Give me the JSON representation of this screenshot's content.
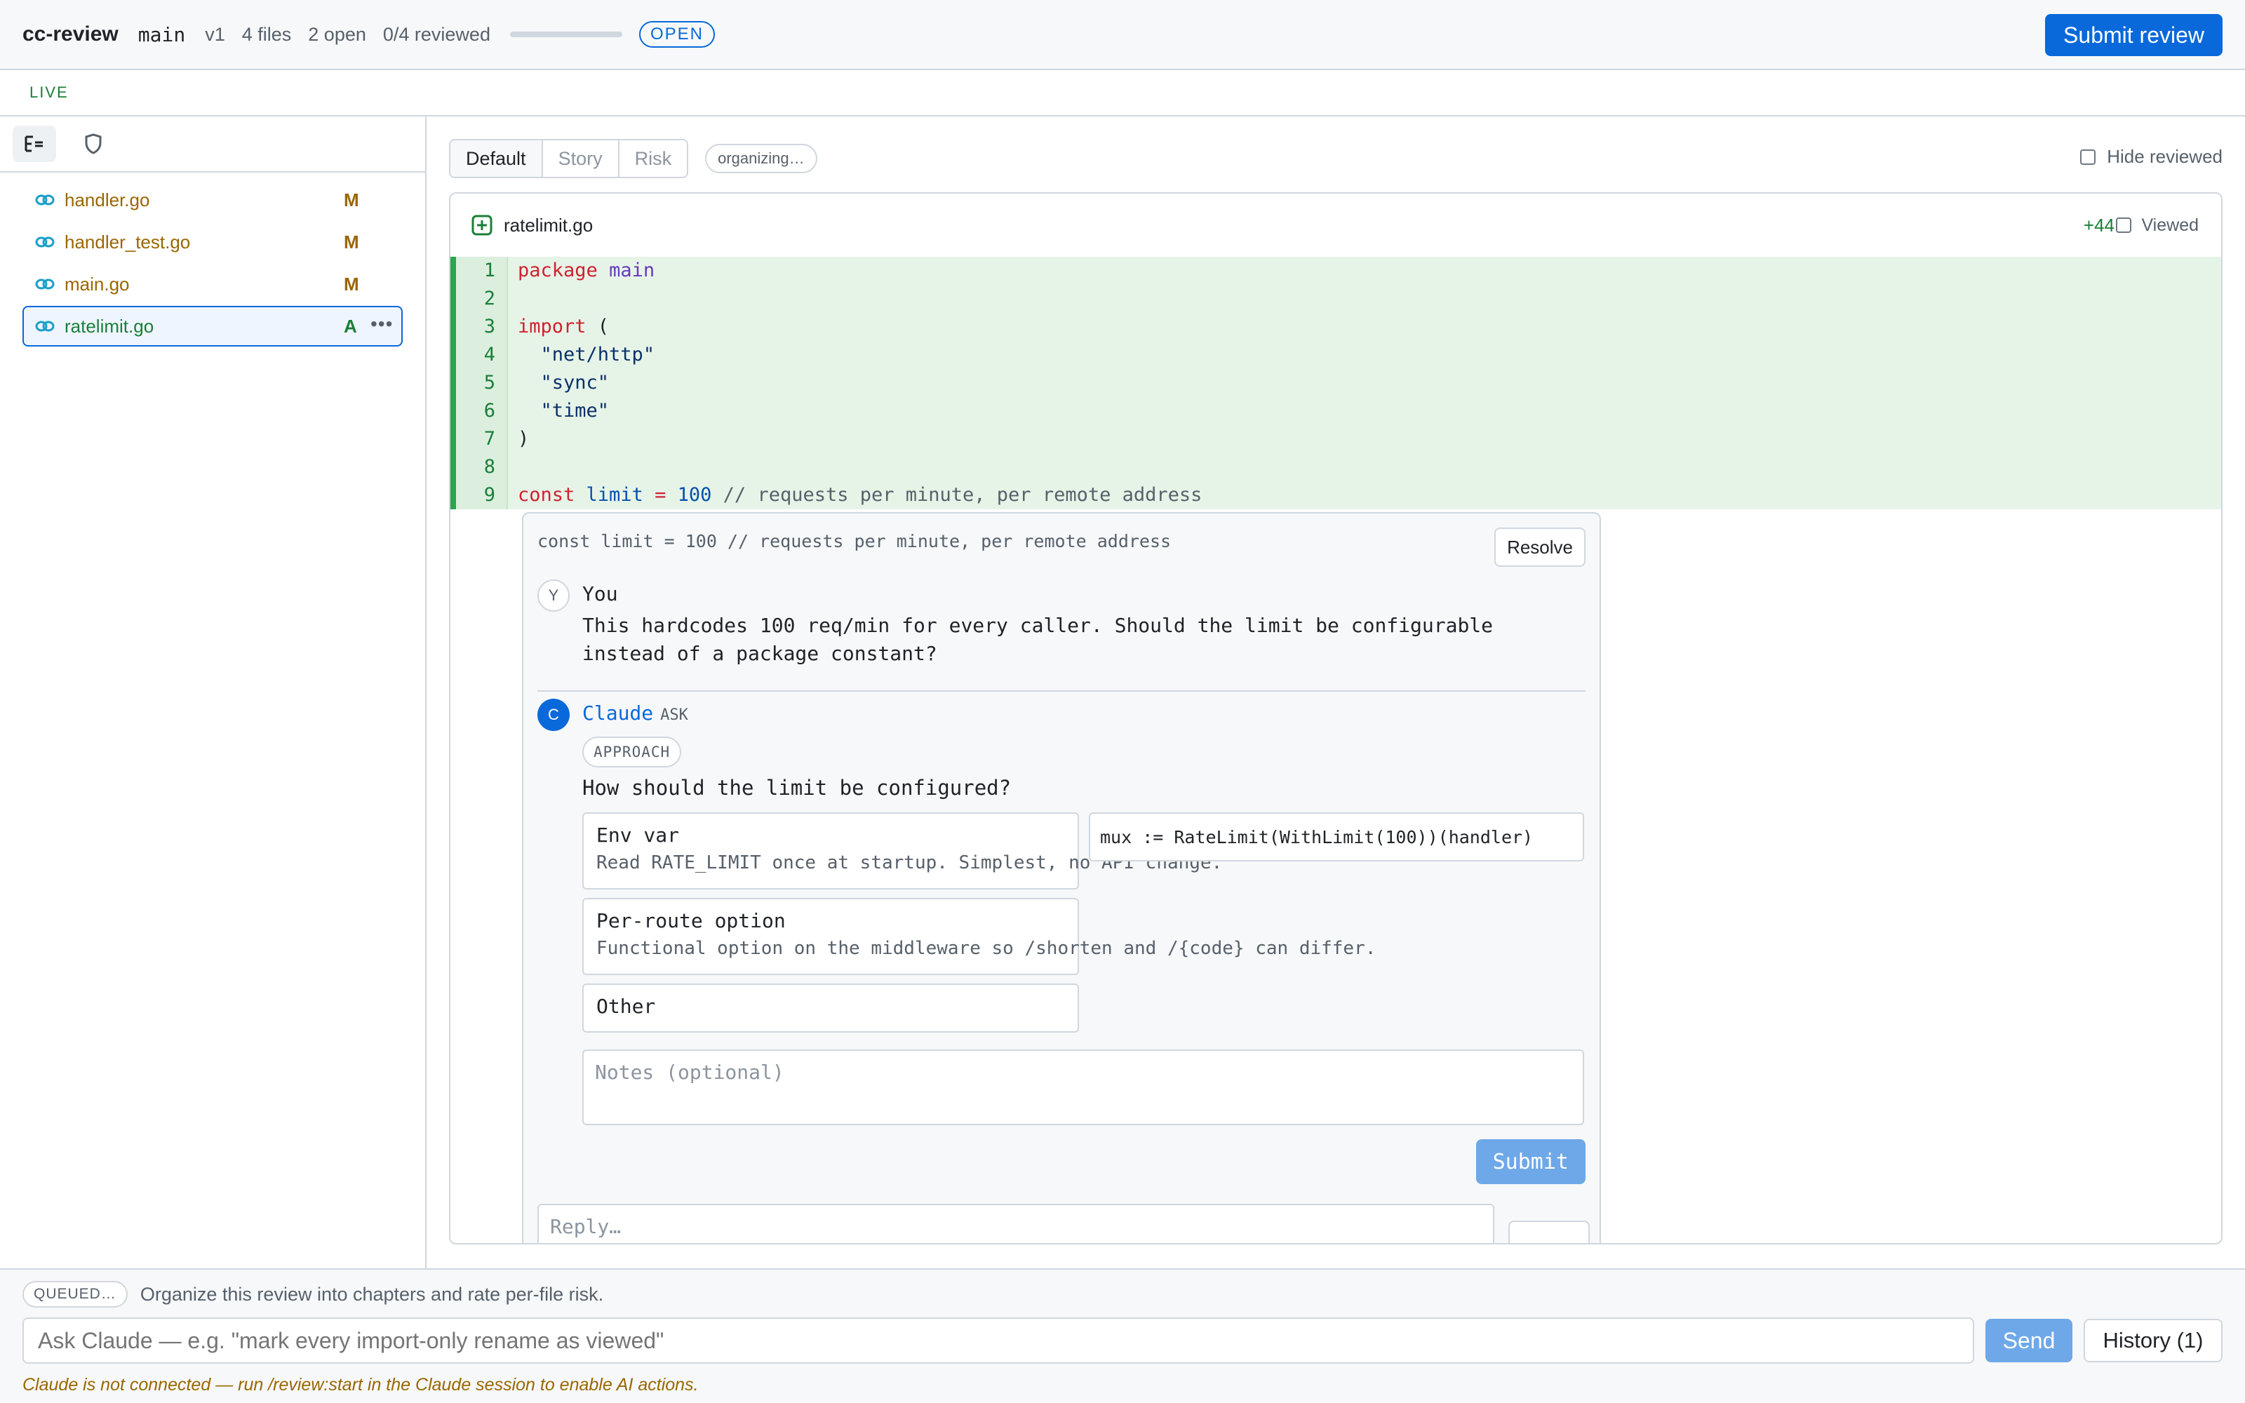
{
  "header": {
    "app_name": "cc-review",
    "branch": "main",
    "version": "v1",
    "files": "4 files",
    "open": "2 open",
    "reviewed": "0/4 reviewed",
    "reviewed_fraction": 0.0,
    "status": "OPEN",
    "submit_label": "Submit review",
    "accent_color": "#0969da"
  },
  "live_label": "LIVE",
  "sidebar": {
    "tools": [
      "tree-view-icon",
      "shield-icon"
    ],
    "files": [
      {
        "name": "handler.go",
        "status": "M"
      },
      {
        "name": "handler_test.go",
        "status": "M"
      },
      {
        "name": "main.go",
        "status": "M"
      },
      {
        "name": "ratelimit.go",
        "status": "A",
        "selected": true
      }
    ]
  },
  "toolbar": {
    "views": [
      "Default",
      "Story",
      "Risk"
    ],
    "active_view": "Default",
    "organizing": "organizing…",
    "hide_reviewed": "Hide reviewed"
  },
  "diff": {
    "file": "ratelimit.go",
    "additions": "+44",
    "viewed_label": "Viewed",
    "line_numbers": [
      "1",
      "2",
      "3",
      "4",
      "5",
      "6",
      "7",
      "8",
      "9"
    ]
  },
  "thread": {
    "context": "const limit = 100 // requests per minute, per remote address",
    "resolve_label": "Resolve",
    "you": {
      "avatar": "Y",
      "author": "You",
      "text": "This hardcodes 100 req/min for every caller. Should the limit be configurable instead of a package constant?"
    },
    "claude": {
      "avatar": "C",
      "author": "Claude",
      "tag": "ASK",
      "category": "APPROACH",
      "question": "How should the limit be configured?",
      "options": [
        {
          "title": "Env var",
          "desc": "Read RATE_LIMIT once at startup. Simplest, no API change."
        },
        {
          "title": "Per-route option",
          "desc": "Functional option on the middleware so /shorten and /{code} can differ."
        },
        {
          "title": "Other",
          "desc": ""
        }
      ],
      "code_preview": "mux := RateLimit(WithLimit(100))(handler)",
      "notes_placeholder": "Notes (optional)",
      "submit_label": "Submit"
    },
    "reply_placeholder": "Reply…"
  },
  "bottom": {
    "queued_badge": "QUEUED…",
    "queued_text": "Organize this review into chapters and rate per-file risk.",
    "ask_placeholder": "Ask Claude — e.g. \"mark every import-only rename as viewed\"",
    "send_label": "Send",
    "history_label": "History (1)",
    "warning": "Claude is not connected — run /review:start in the Claude session to enable AI actions."
  }
}
